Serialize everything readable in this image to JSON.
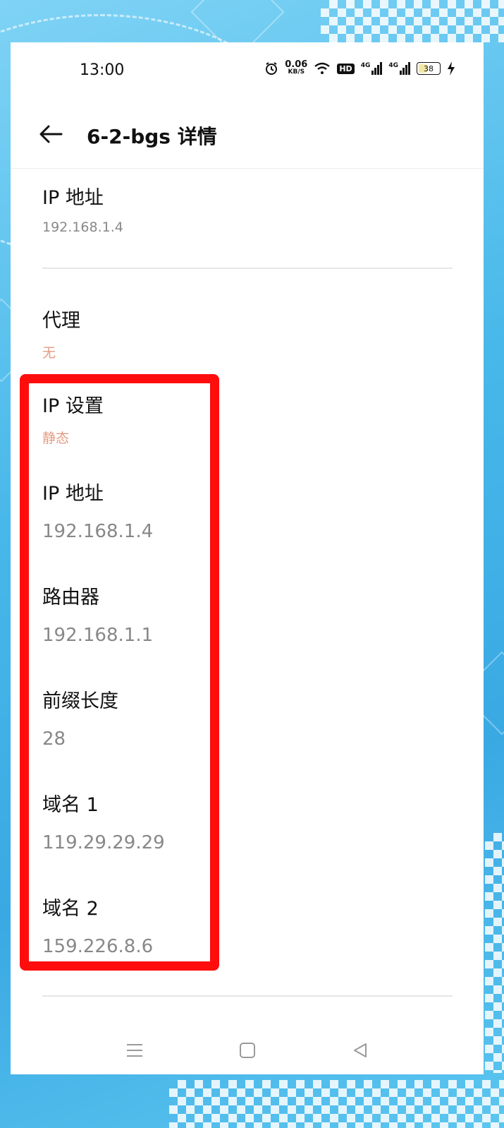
{
  "status_bar": {
    "time": "13:00",
    "net_speed_value": "0.06",
    "net_speed_unit": "KB/S",
    "hd_label": "HD",
    "sim1_label": "4G",
    "sim2_label": "4G",
    "battery_level": "38",
    "icons": [
      "alarm-icon",
      "wifi-icon",
      "hd-icon",
      "signal-icon",
      "battery-icon",
      "charging-icon"
    ]
  },
  "header": {
    "title": "6-2-bgs 详情",
    "back_icon": "arrow-left-icon"
  },
  "details": [
    {
      "label": "IP 地址",
      "value": "192.168.1.4"
    },
    {
      "label": "代理",
      "value": "无"
    },
    {
      "label": "IP 设置",
      "value": "静态"
    },
    {
      "label": "IP 地址",
      "value": "192.168.1.4"
    },
    {
      "label": "路由器",
      "value": "192.168.1.1"
    },
    {
      "label": "前缀长度",
      "value": "28"
    },
    {
      "label": "域名 1",
      "value": "119.29.29.29"
    },
    {
      "label": "域名 2",
      "value": "159.226.8.6"
    }
  ],
  "colors": {
    "accent_value": "#e39b83",
    "highlight": "#ff0d0d",
    "background": "#48b8ea"
  },
  "nav_bar": {
    "icons": [
      "menu-icon",
      "home-square-icon",
      "back-triangle-icon"
    ]
  }
}
